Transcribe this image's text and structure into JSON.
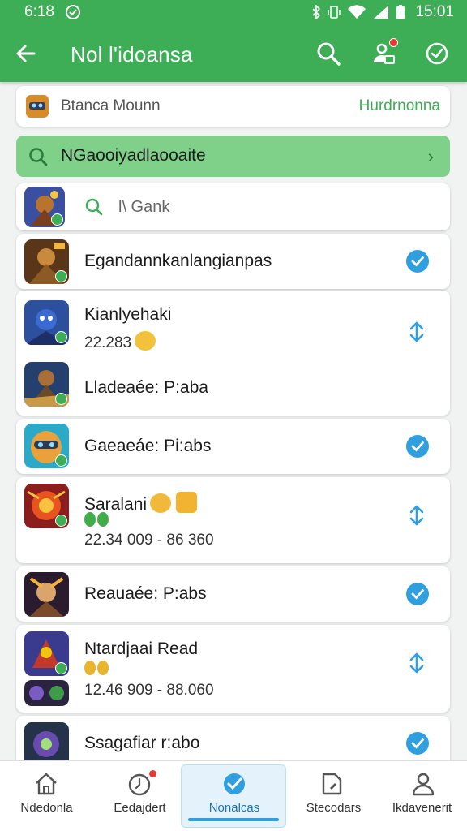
{
  "status_bar": {
    "time": "6:18",
    "clock_right": "15:01"
  },
  "header": {
    "title": "Nol l'idoansa",
    "back_icon": "arrow-left-icon",
    "actions": [
      {
        "icon": "search-icon"
      },
      {
        "icon": "user-upload-icon"
      },
      {
        "icon": "clock-check-icon"
      }
    ],
    "color": "#3dae55"
  },
  "account": {
    "name": "Btanca Mounn",
    "action": "Hurdrnonna"
  },
  "green_search": {
    "label": "NGaooiyadlaooaite",
    "color": "#7fd18a"
  },
  "filter": {
    "value": "l\\ Gank",
    "placeholder": "l\\ Gank"
  },
  "games": [
    {
      "name": "Egandannkanlangianpas",
      "status": "checked"
    },
    {
      "name": "Kianlyehaki",
      "meta": "22.283",
      "status": "sync"
    },
    {
      "name": "Lladeaée: P:aba",
      "status": "none"
    },
    {
      "name": "Gaeaeáe: Pi:abs",
      "status": "checked"
    },
    {
      "name": "Saralani",
      "meta": "22.34 009 - 86 360",
      "status": "sync"
    },
    {
      "name": "Reauaée: P:abs",
      "status": "checked"
    },
    {
      "name": "Ntardjaai Read",
      "meta": "12.46 909 - 88.060",
      "status": "sync"
    },
    {
      "name": "Ssagafiar r:abo",
      "status": "checked"
    }
  ],
  "bottom_nav": [
    {
      "label": "Ndedonla",
      "icon": "home-icon"
    },
    {
      "label": "Eedajdert",
      "icon": "clock-icon"
    },
    {
      "label": "Nonalcas",
      "icon": "check-icon",
      "active": true
    },
    {
      "label": "Stecodars",
      "icon": "folder-icon"
    },
    {
      "label": "Ikdavenerit",
      "icon": "person-icon"
    }
  ],
  "accent_blue": "#2f9fe0"
}
